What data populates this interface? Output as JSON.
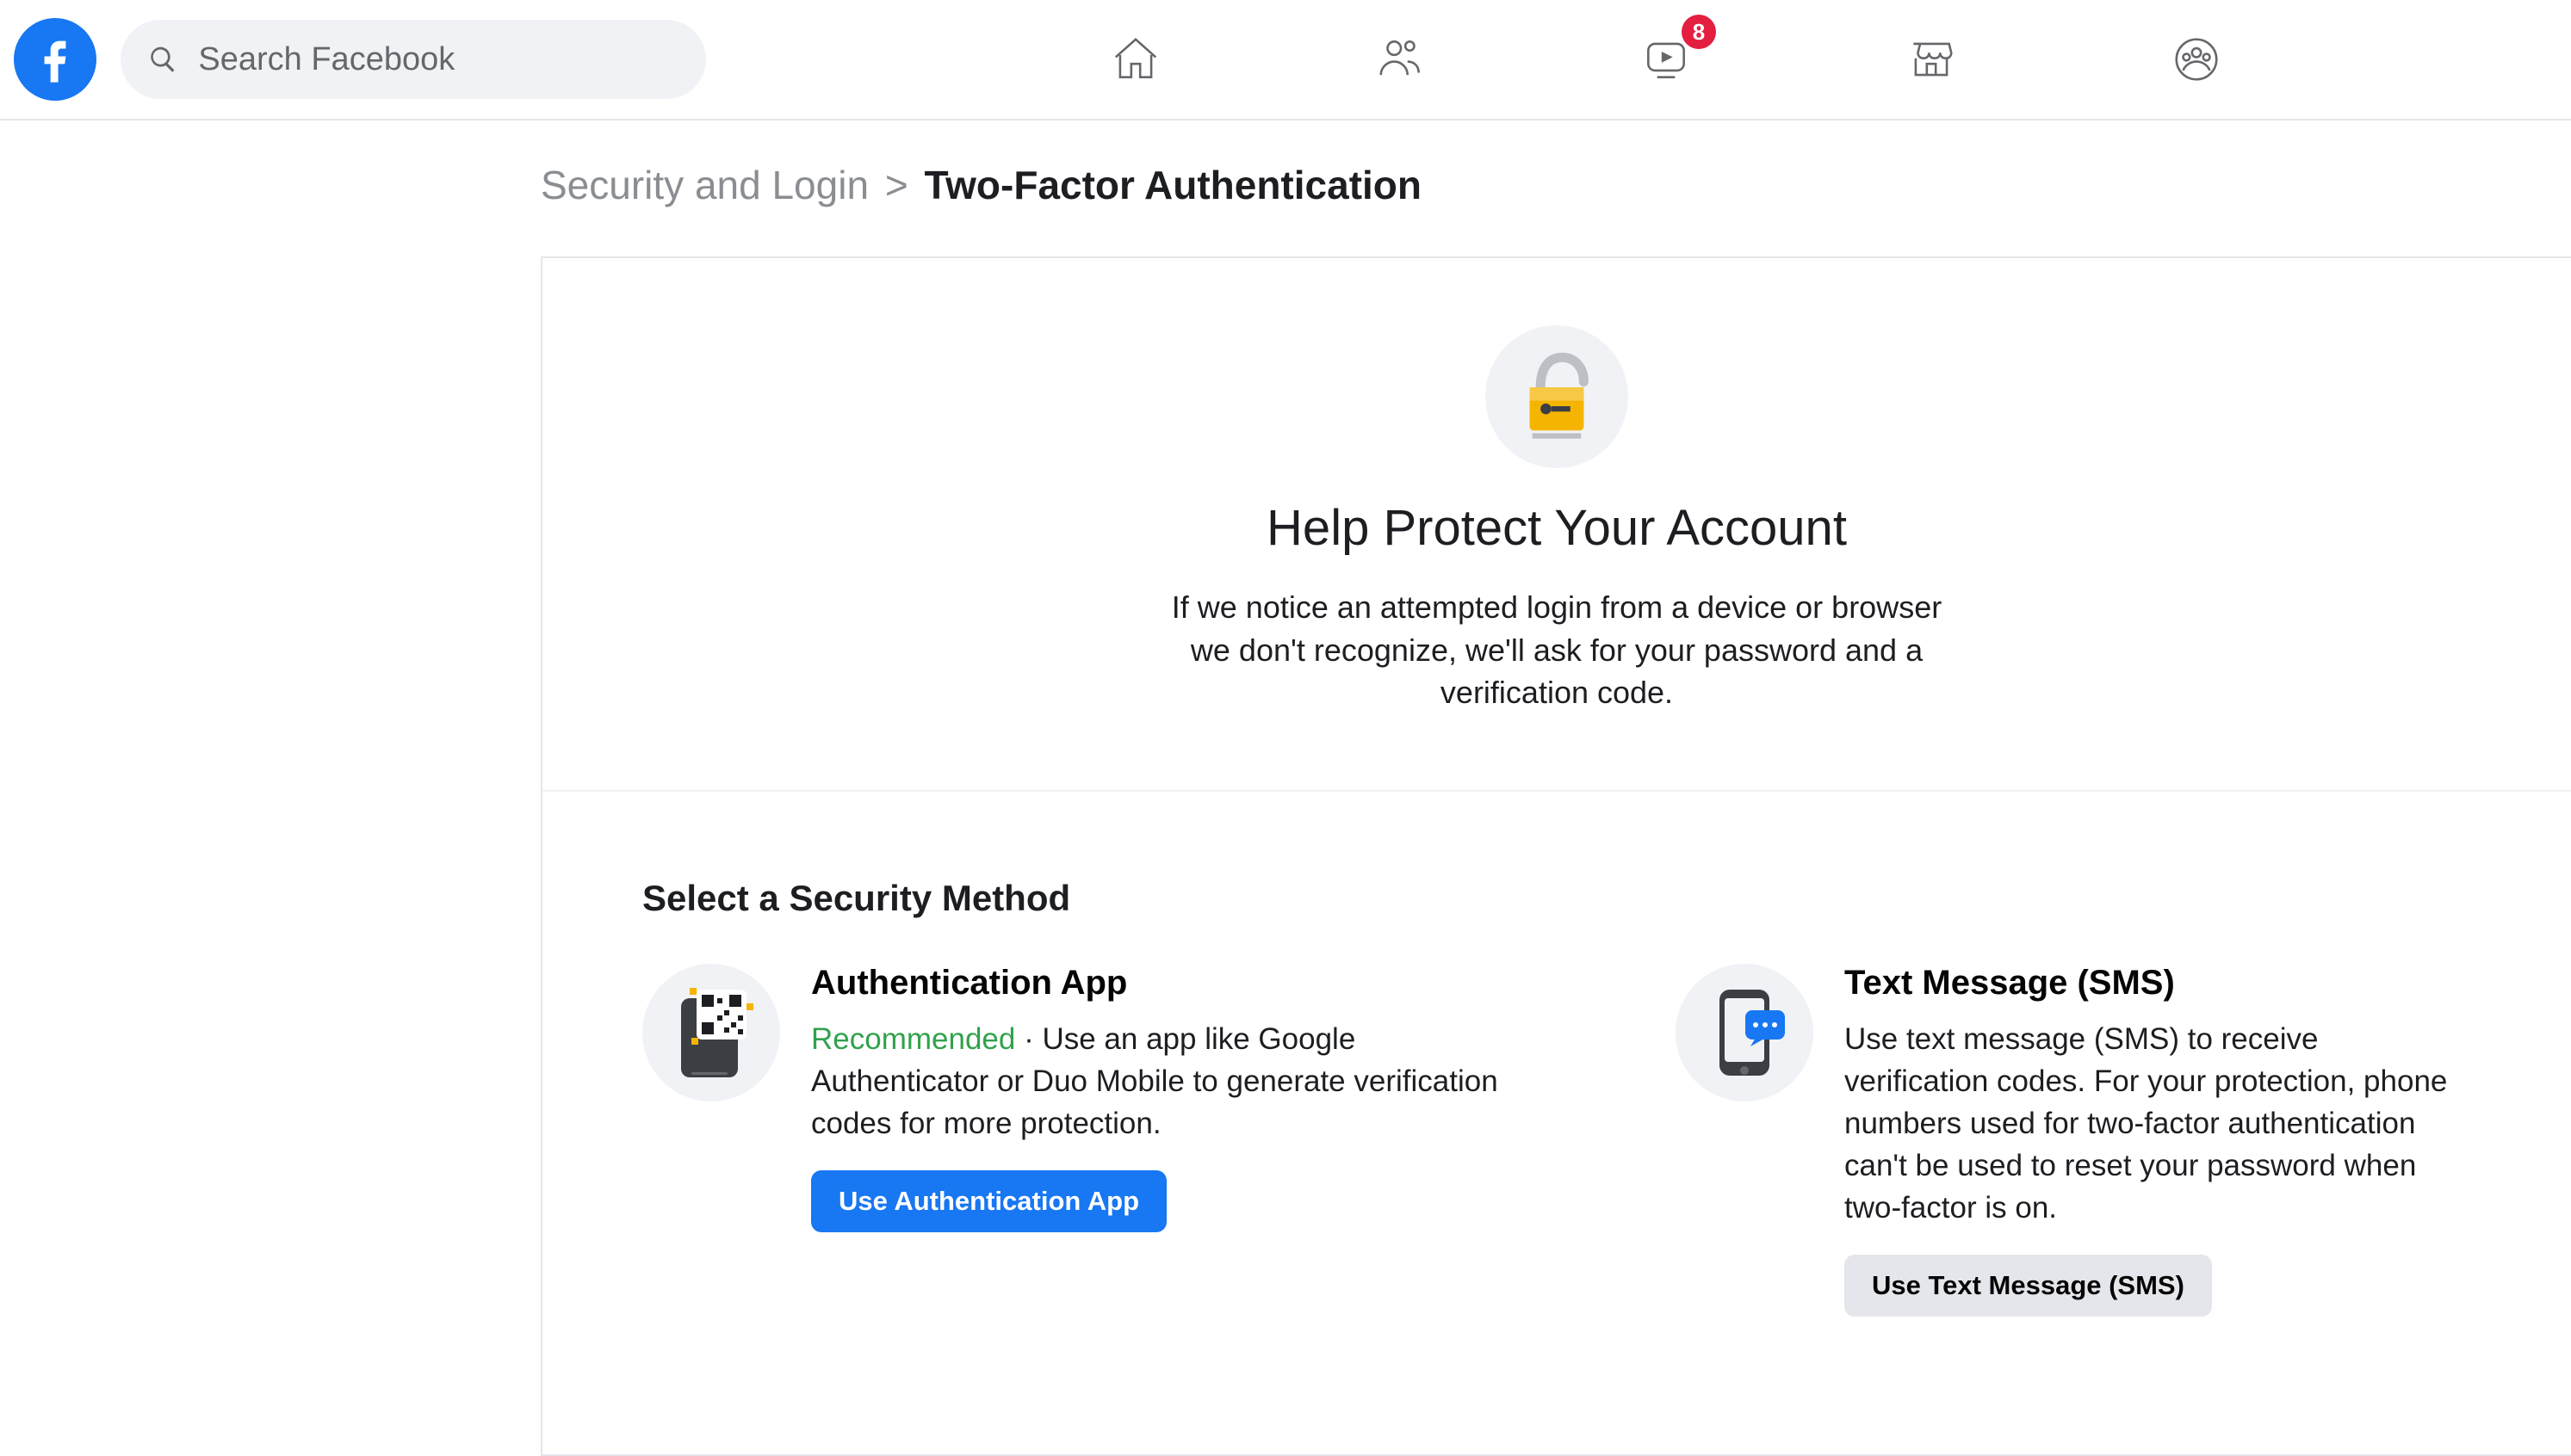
{
  "search": {
    "placeholder": "Search Facebook"
  },
  "nav": {
    "watch_badge": "8"
  },
  "breadcrumb": {
    "parent": "Security and Login",
    "sep": ">",
    "current": "Two-Factor Authentication"
  },
  "hero": {
    "title": "Help Protect Your Account",
    "subtitle": "If we notice an attempted login from a device or browser we don't recognize, we'll ask for your password and a verification code."
  },
  "methods": {
    "heading": "Select a Security Method",
    "app": {
      "title": "Authentication App",
      "recommended": "Recommended",
      "desc": " · Use an app like Google Authenticator or Duo Mobile to generate verification codes for more protection.",
      "button": "Use Authentication App"
    },
    "sms": {
      "title": "Text Message (SMS)",
      "desc": "Use text message (SMS) to receive verification codes. For your protection, phone numbers used for two-factor authentication can't be used to reset your password when two-factor is on.",
      "button": "Use Text Message (SMS)"
    }
  }
}
